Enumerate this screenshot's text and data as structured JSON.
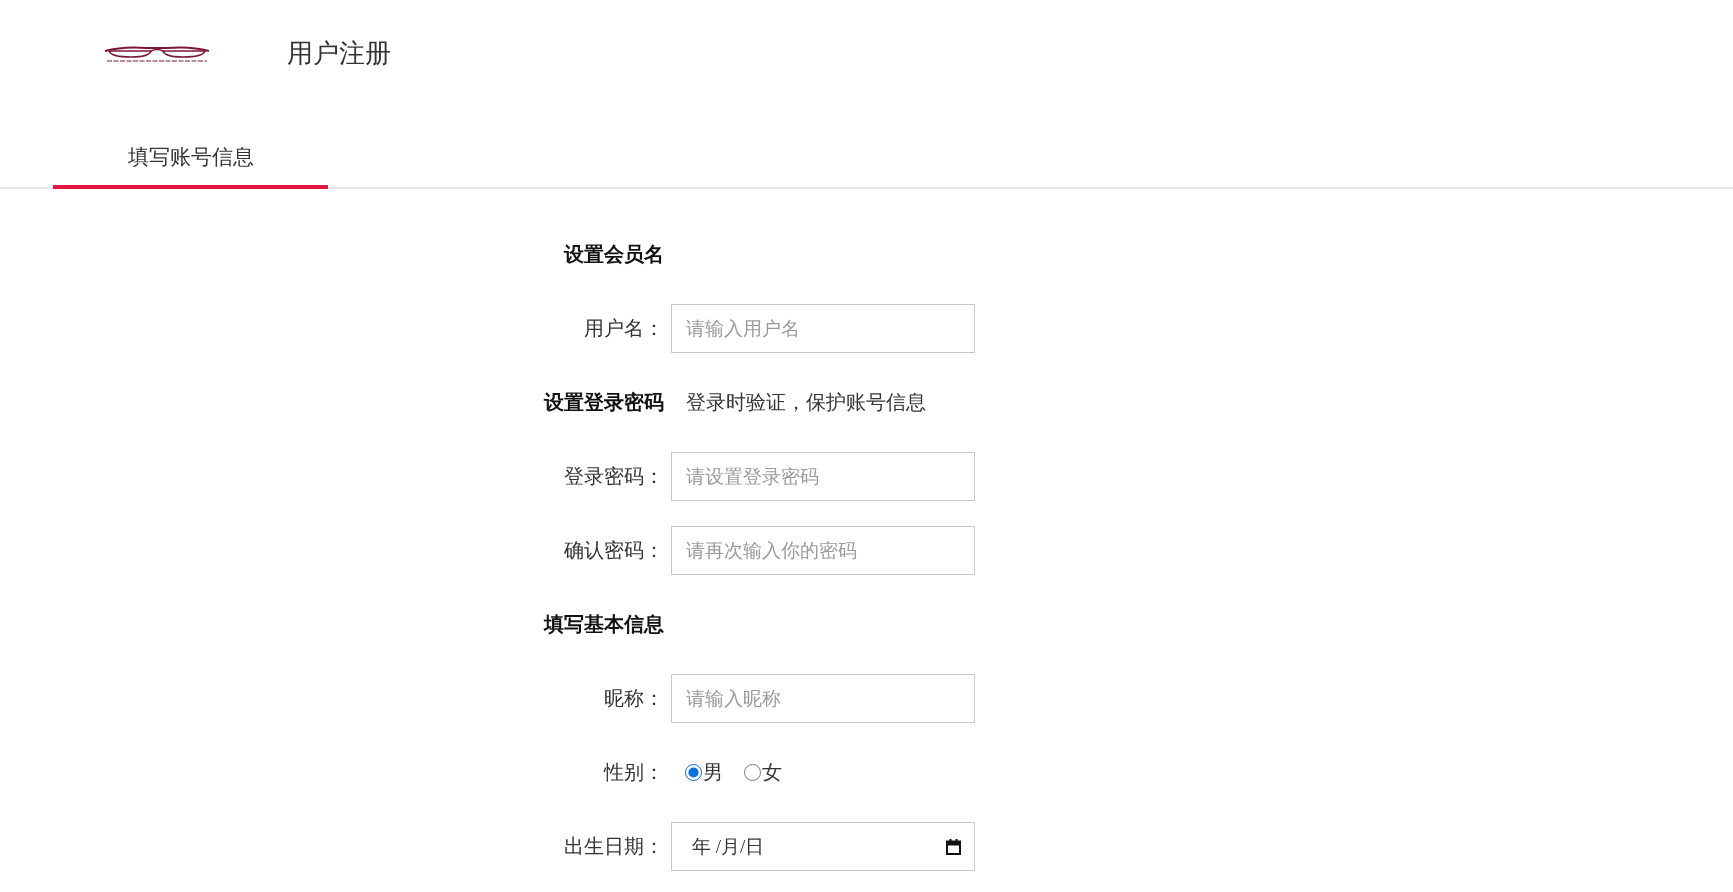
{
  "header": {
    "title": "用户注册"
  },
  "tabs": [
    {
      "label": "填写账号信息",
      "selected": true
    }
  ],
  "form": {
    "sections": [
      {
        "heading": "设置会员名",
        "fields": [
          {
            "kind": "text",
            "label": "用户名：",
            "placeholder": "请输入用户名"
          }
        ]
      },
      {
        "heading": "设置登录密码",
        "hint": "登录时验证，保护账号信息",
        "fields": [
          {
            "kind": "password",
            "label": "登录密码：",
            "placeholder": "请设置登录密码"
          },
          {
            "kind": "password",
            "label": "确认密码：",
            "placeholder": "请再次输入你的密码"
          }
        ]
      },
      {
        "heading": "填写基本信息",
        "fields": [
          {
            "kind": "text",
            "label": "昵称：",
            "placeholder": "请输入昵称"
          },
          {
            "kind": "radio",
            "label": "性别：",
            "options": [
              {
                "label": "男",
                "selected": true
              },
              {
                "label": "女",
                "selected": false
              }
            ]
          },
          {
            "kind": "date",
            "label": "出生日期：",
            "placeholder": "年 /月/日"
          }
        ]
      }
    ]
  }
}
